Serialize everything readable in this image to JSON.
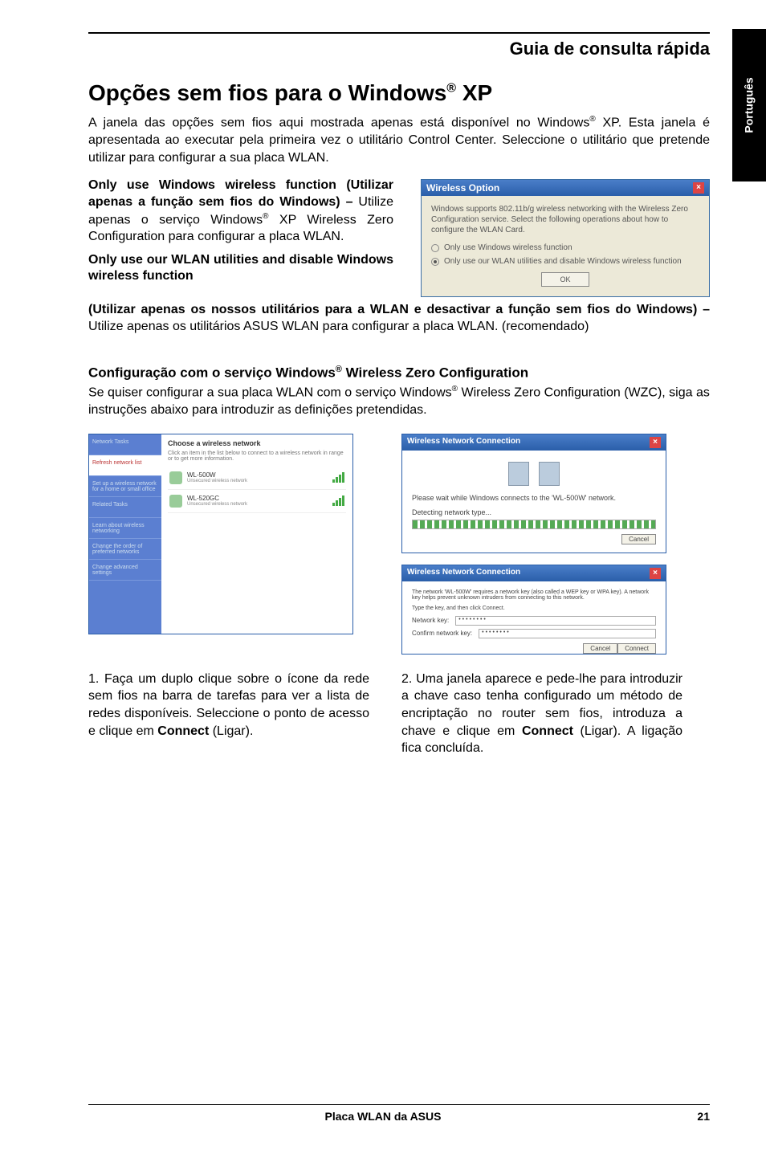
{
  "sideTab": "Português",
  "headerTitle": "Guia de consulta rápida",
  "h1_a": "Opções sem fios para o Windows",
  "h1_sup": "®",
  "h1_b": " XP",
  "intro_a": "A janela das opções sem fios aqui mostrada apenas está disponível no Windows",
  "intro_sup1": "®",
  "intro_b": " XP. Esta janela é apresentada ao executar pela primeira vez o utilitário Control Center. Seleccione o utilitário que pretende utilizar para configurar a sua placa WLAN.",
  "opt1_bold": "Only use Windows wireless function (Utilizar apenas a função sem fios do Windows) –",
  "opt1_rest_a": " Utilize apenas o serviço Windows",
  "opt1_sup": "®",
  "opt1_rest_b": " XP Wireless Zero Configuration para configurar a placa WLAN.",
  "opt2_bold1": "Only use our WLAN utilities and disable Windows wireless function",
  "opt2_bold2": "(Utilizar apenas os nossos utilitários para a WLAN e desactivar a função sem fios do Windows) –",
  "opt2_rest": " Utilize apenas os utilitários ASUS WLAN para configurar a placa WLAN. (recomendado)",
  "dialog": {
    "title": "Wireless Option",
    "desc": "Windows supports 802.11b/g wireless networking with the Wireless Zero Configuration service. Select the following operations about how to configure the WLAN Card.",
    "radio1": "Only use Windows wireless function",
    "radio2": "Only use our WLAN utilities and disable Windows wireless function",
    "ok": "OK"
  },
  "sub_a": "Configuração com o serviço Windows",
  "sub_sup": "®",
  "sub_b": " Wireless Zero Configuration",
  "subdesc_a": "Se quiser configurar a sua placa WLAN com o serviço Windows",
  "subdesc_sup": "®",
  "subdesc_b": " Wireless Zero Configuration (WZC), siga as instruções abaixo para introduzir as definições pretendidas.",
  "shot1": {
    "head": "Choose a wireless network",
    "desc": "Click an item in the list below to connect to a wireless network in range or to get more information.",
    "net1": "WL-500W",
    "net1sub": "Unsecured wireless network",
    "net2": "WL-520GC",
    "net2sub": "Unsecured wireless network",
    "side0": "Network Tasks",
    "side1": "Refresh network list",
    "side2": "Set up a wireless network for a home or small office",
    "side3": "Related Tasks",
    "side4": "Learn about wireless networking",
    "side5": "Change the order of preferred networks",
    "side6": "Change advanced settings"
  },
  "shot2a": {
    "title": "Wireless Network Connection",
    "msg": "Please wait while Windows connects to the 'WL-500W' network.",
    "label": "Detecting network type...",
    "cancel": "Cancel"
  },
  "shot2b": {
    "title": "Wireless Network Connection",
    "desc": "The network 'WL-500W' requires a network key (also called a WEP key or WPA key). A network key helps prevent unknown intruders from connecting to this network.",
    "hint": "Type the key, and then click Connect.",
    "k1": "Network key:",
    "k2": "Confirm network key:",
    "dots": "••••••••",
    "connect": "Connect",
    "cancel": "Cancel"
  },
  "step1_a": "1. Faça um duplo clique sobre o ícone da rede sem fios na barra de tarefas para ver a lista de redes disponíveis. Seleccione o ponto de acesso e clique em ",
  "step1_bold": "Connect",
  "step1_b": " (Ligar).",
  "step2_a": "2. Uma janela aparece e pede-lhe para introduzir a chave caso tenha configurado um método de encriptação no router sem fios, introduza a chave e clique em ",
  "step2_bold": "Connect",
  "step2_b": " (Ligar). A ligação fica concluída.",
  "footer": {
    "center": "Placa WLAN da ASUS",
    "page": "21"
  }
}
